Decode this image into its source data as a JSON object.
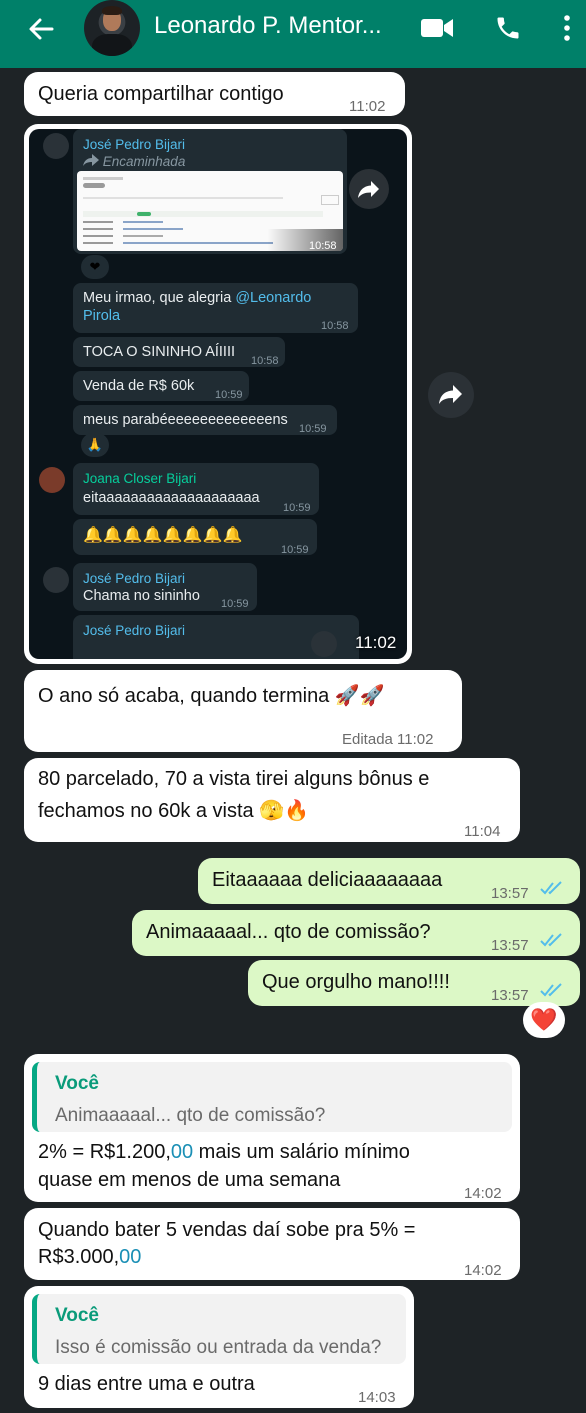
{
  "header": {
    "contact_name": "Leonardo P. Mentor..."
  },
  "messages": {
    "m1": {
      "text": "Queria compartilhar contigo",
      "time": "11:02"
    },
    "forward": {
      "time": "11:02",
      "inner": {
        "sender1": "José Pedro Bijari",
        "forwarded_label": "Encaminhada",
        "doc_time": "10:58",
        "reaction1": "❤",
        "msg1_a": "Meu irmao, que alegria ",
        "msg1_mention_a": "@Leonardo",
        "msg1_mention_b": "Pirola",
        "msg1_time": "10:58",
        "msg2": "TOCA O SININHO AÍIIII",
        "msg2_time": "10:58",
        "msg3": "Venda de R$ 60k",
        "msg3_time": "10:59",
        "msg4": "meus parabéeeeeeeeeeeeeens",
        "msg4_time": "10:59",
        "reaction2": "🙏",
        "sender2": "Joana Closer Bijari",
        "msg5": "eitaaaaaaaaaaaaaaaaaaaa",
        "msg5_time": "10:59",
        "bells": "🔔🔔🔔🔔🔔🔔🔔🔔",
        "bells_time": "10:59",
        "sender3": "José Pedro Bijari",
        "msg6": "Chama no sininho",
        "msg6_time": "10:59",
        "sender4": "José Pedro Bijari"
      }
    },
    "m2": {
      "text": "O ano só acaba, quando termina 🚀🚀",
      "status": "Editada 11:02"
    },
    "m3": {
      "line1": "80 parcelado, 70 a vista tirei alguns bônus e",
      "line2": "fechamos no 60k a vista 🫣🔥",
      "time": "11:04"
    },
    "o1": {
      "text": "Eitaaaaaa deliciaaaaaaaa",
      "time": "13:57"
    },
    "o2": {
      "text": "Animaaaaal... qto de comissão?",
      "time": "13:57"
    },
    "o3": {
      "text": "Que orgulho mano!!!!",
      "time": "13:57",
      "reaction": "❤️"
    },
    "r1": {
      "quote_name": "Você",
      "quote_text": "Animaaaaal... qto de comissão?",
      "line1_a": "2% = R$1.200,",
      "line1_b": "00",
      "line1_c": " mais um salário mínimo",
      "line2": "quase em menos de uma semana",
      "time": "14:02"
    },
    "r2": {
      "line1": "Quando bater 5 vendas daí sobe pra 5% =",
      "line2_a": "R$3.000,",
      "line2_b": "00",
      "time": "14:02"
    },
    "r3": {
      "quote_name": "Você",
      "quote_text": "Isso é comissão ou entrada da venda?",
      "text": "9 dias entre uma e outra",
      "time": "14:03"
    }
  },
  "colors": {
    "header": "#008069",
    "background": "#1e2326",
    "outgoing": "#dcf8c6",
    "incoming": "#ffffff",
    "read_ticks": "#53bdeb"
  },
  "icons": [
    "back-arrow-icon",
    "video-call-icon",
    "phone-icon",
    "more-options-icon",
    "forward-icon",
    "double-check-icon",
    "heart-reaction-icon"
  ]
}
